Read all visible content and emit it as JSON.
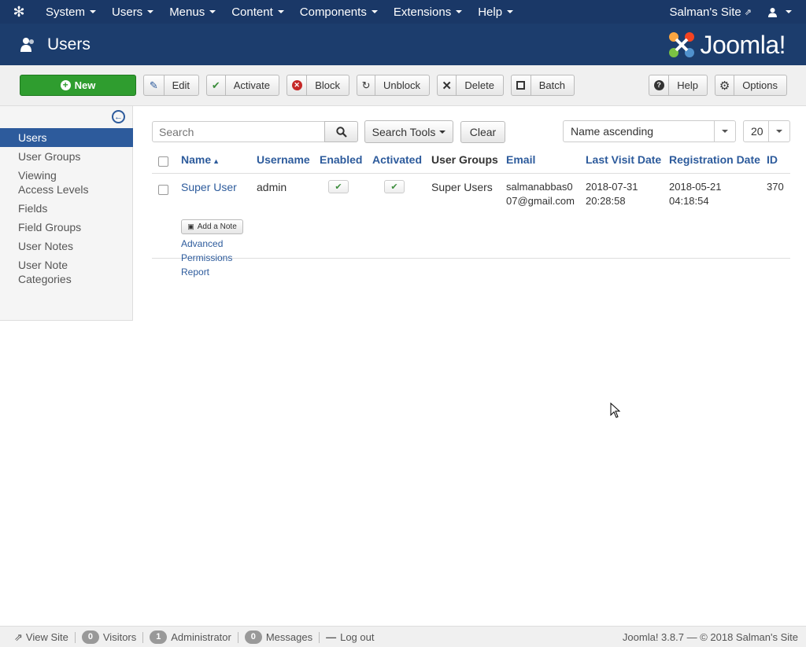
{
  "topnav": {
    "menu": [
      "System",
      "Users",
      "Menus",
      "Content",
      "Components",
      "Extensions",
      "Help"
    ],
    "site_link": "Salman's Site"
  },
  "header": {
    "title": "Users",
    "brand": "Joomla!"
  },
  "toolbar": {
    "new": "New",
    "edit": "Edit",
    "activate": "Activate",
    "block": "Block",
    "unblock": "Unblock",
    "delete": "Delete",
    "batch": "Batch",
    "help": "Help",
    "options": "Options"
  },
  "sidebar": {
    "items": [
      "Users",
      "User Groups",
      "Viewing Access Levels",
      "Fields",
      "Field Groups",
      "User Notes",
      "User Note Categories"
    ]
  },
  "filters": {
    "search_placeholder": "Search",
    "search_tools": "Search Tools",
    "clear": "Clear",
    "ordering": "Name ascending",
    "limit": "20"
  },
  "table": {
    "headers": {
      "name": "Name",
      "username": "Username",
      "enabled": "Enabled",
      "activated": "Activated",
      "user_groups": "User Groups",
      "email": "Email",
      "last_visit": "Last Visit Date",
      "registration": "Registration Date",
      "id": "ID"
    },
    "rows": [
      {
        "name": "Super User",
        "add_note": "Add a Note",
        "advanced": "Advanced Permissions Report",
        "username": "admin",
        "user_groups": "Super Users",
        "email": "salmanabbas007@gmail.com",
        "last_visit": "2018-07-31 20:28:58",
        "registration": "2018-05-21 04:18:54",
        "id": "370"
      }
    ]
  },
  "footer": {
    "view_site": "View Site",
    "visitors_count": "0",
    "visitors": "Visitors",
    "admin_count": "1",
    "admin": "Administrator",
    "messages_count": "0",
    "messages": "Messages",
    "logout": "Log out",
    "version": "Joomla! 3.8.7 — © 2018 Salman's Site"
  },
  "colors": {
    "nav": "#1a3867",
    "header": "#1c3d6d",
    "accent": "#2d5b9c",
    "new_button": "#2f9d2f"
  }
}
